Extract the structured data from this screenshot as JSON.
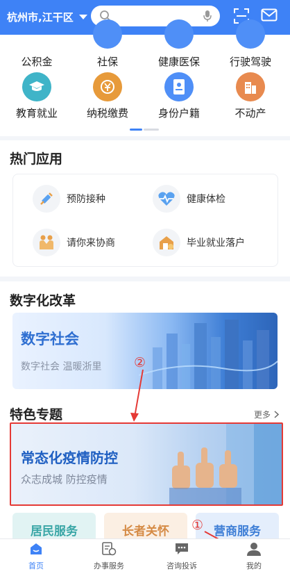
{
  "header": {
    "location": "杭州市,江干区",
    "search_placeholder": ""
  },
  "services": {
    "row1": [
      "公积金",
      "社保",
      "健康医保",
      "行驶驾驶"
    ],
    "row2": [
      "教育就业",
      "纳税缴费",
      "身份户籍",
      "不动产"
    ]
  },
  "hot_apps": {
    "title": "热门应用",
    "items": [
      "预防接种",
      "健康体检",
      "请你来协商",
      "毕业就业落户"
    ]
  },
  "digital_reform": {
    "title": "数字化改革",
    "banner_title": "数字社会",
    "banner_subtitle": "数字社会 温暖浙里"
  },
  "featured": {
    "title": "特色专题",
    "more_label": "更多",
    "banner_title": "常态化疫情防控",
    "banner_subtitle": "众志成城   防控疫情"
  },
  "mini_cards": [
    "居民服务",
    "长者关怀",
    "营商服务"
  ],
  "annotations": {
    "marker1": "①",
    "marker2": "②"
  },
  "bottom_nav": {
    "items": [
      "首页",
      "办事服务",
      "咨询投诉",
      "我的"
    ],
    "active": "首页"
  },
  "colors": {
    "primary": "#3e82f6",
    "annotation_red": "#e53935"
  }
}
